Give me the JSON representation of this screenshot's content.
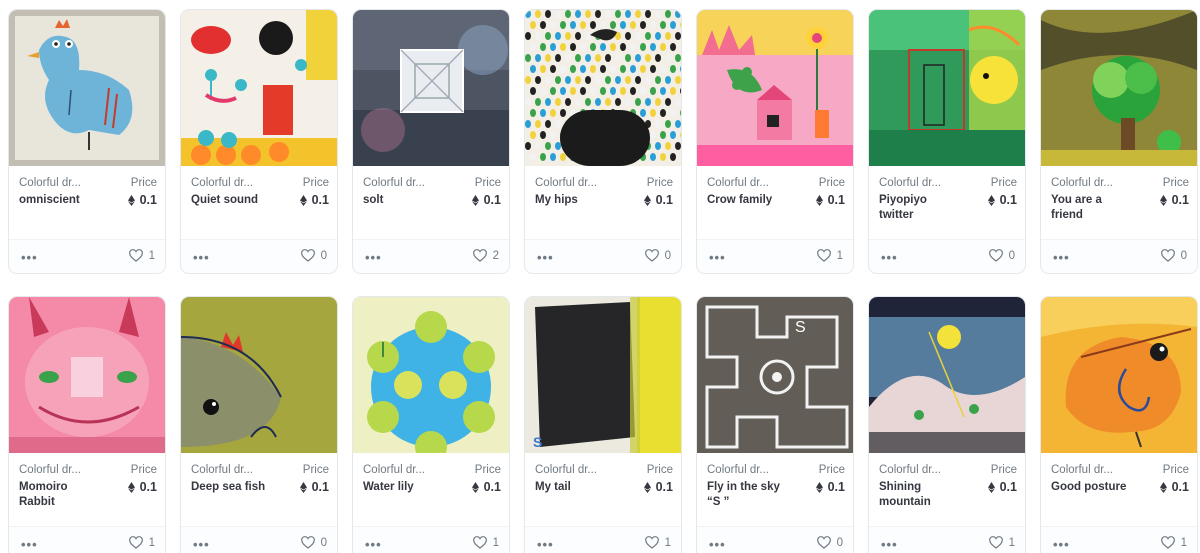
{
  "labels": {
    "price_label": "Price",
    "more_icon_text": "•••"
  },
  "cards": [
    {
      "collection": "Colorful dr...",
      "name": "omniscient",
      "price": "0.1",
      "favorites": "1",
      "art": "blue-bird"
    },
    {
      "collection": "Colorful dr...",
      "name": "Quiet sound",
      "price": "0.1",
      "favorites": "0",
      "art": "quiet-sound"
    },
    {
      "collection": "Colorful dr...",
      "name": "solt",
      "price": "0.1",
      "favorites": "2",
      "art": "square"
    },
    {
      "collection": "Colorful dr...",
      "name": "My hips",
      "price": "0.1",
      "favorites": "0",
      "art": "dots"
    },
    {
      "collection": "Colorful dr...",
      "name": "Crow family",
      "price": "0.1",
      "favorites": "1",
      "art": "pink-city"
    },
    {
      "collection": "Colorful dr...",
      "name": "Piyopiyo twitter",
      "price": "0.1",
      "favorites": "0",
      "art": "green-yellow"
    },
    {
      "collection": "Colorful dr...",
      "name": "You are a friend",
      "price": "0.1",
      "favorites": "0",
      "art": "tree"
    },
    {
      "collection": "Colorful dr...",
      "name": "Momoiro Rabbit",
      "price": "0.1",
      "favorites": "1",
      "art": "pink-rabbit"
    },
    {
      "collection": "Colorful dr...",
      "name": "Deep sea fish",
      "price": "0.1",
      "favorites": "0",
      "art": "fish"
    },
    {
      "collection": "Colorful dr...",
      "name": "Water lily",
      "price": "0.1",
      "favorites": "1",
      "art": "lily"
    },
    {
      "collection": "Colorful dr...",
      "name": "My tail",
      "price": "0.1",
      "favorites": "1",
      "art": "dark-yellow"
    },
    {
      "collection": "Colorful dr...",
      "name": "Fly in the sky “S ”",
      "price": "0.1",
      "favorites": "0",
      "art": "maze"
    },
    {
      "collection": "Colorful dr...",
      "name": "Shining mountain",
      "price": "0.1",
      "favorites": "1",
      "art": "mountain"
    },
    {
      "collection": "Colorful dr...",
      "name": "Good posture",
      "price": "0.1",
      "favorites": "1",
      "art": "orange-bird"
    }
  ]
}
